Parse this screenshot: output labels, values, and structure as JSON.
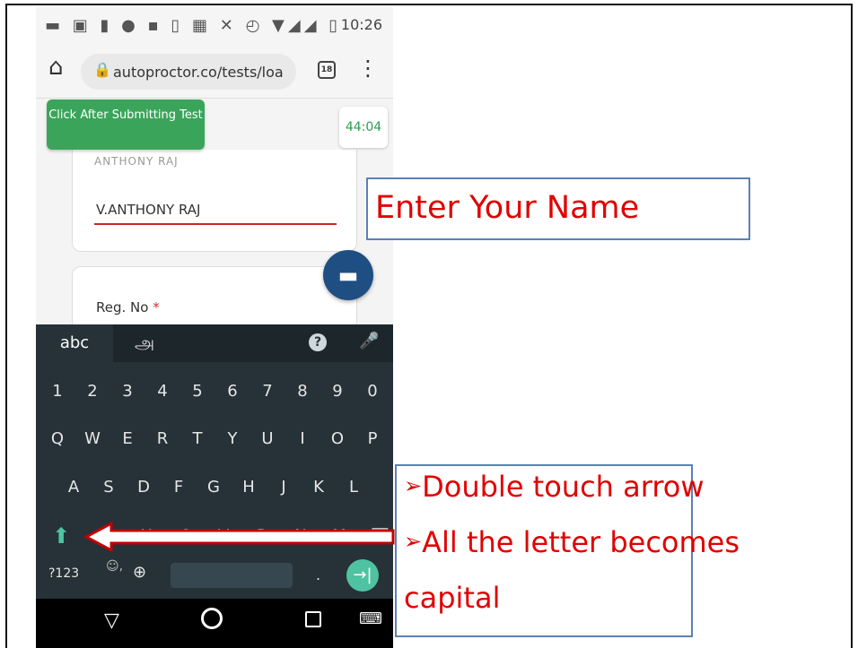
{
  "status_bar": {
    "icons": "▬ ▣ ▮ ● ▪ ▯ ▦ ✕ ◴ ▼◢◢ ▯",
    "time": "10:26"
  },
  "browser": {
    "home_icon": "⌂",
    "lock_icon": "🔒",
    "url": "autoproctor.co/tests/loa",
    "tab_count": "18",
    "menu_icon": "⋮"
  },
  "page": {
    "green_button": "Click After Submitting Test",
    "timer": "44:04",
    "faded_text": "ANTHONY RAJ",
    "name_value": "V.ANTHONY RAJ",
    "reg_label": "Reg. No",
    "required_star": "*",
    "chat_icon": "▬"
  },
  "keyboard": {
    "abc_tab": "abc",
    "tamil_tab": "அ",
    "help_icon": "?",
    "mic_icon": "🎤",
    "row_numbers": [
      "1",
      "2",
      "3",
      "4",
      "5",
      "6",
      "7",
      "8",
      "9",
      "0"
    ],
    "row_q": [
      "Q",
      "W",
      "E",
      "R",
      "T",
      "Y",
      "U",
      "I",
      "O",
      "P"
    ],
    "row_a": [
      "A",
      "S",
      "D",
      "F",
      "G",
      "H",
      "J",
      "K",
      "L"
    ],
    "row_z": [
      "Z",
      "X",
      "C",
      "V",
      "B",
      "N",
      "M",
      "⌫"
    ],
    "shift_icon": "⬆",
    "sym_key": "?123",
    "emoji_key": "☺,",
    "globe_key": "⊕",
    "period_key": ".",
    "enter_key": "→|"
  },
  "nav": {
    "back_icon": "▽",
    "keyboard_icon": "⌨"
  },
  "callouts": {
    "name_hint": "Enter Your Name",
    "bullet": "➢",
    "line1": "Double touch arrow",
    "line2": "All the letter becomes",
    "line3": "capital"
  },
  "colors": {
    "callout_text": "#e00000",
    "callout_border": "#5b80b7",
    "green_button": "#3aa55a",
    "keyboard_bg": "#263238",
    "accent_teal": "#4fc3a1",
    "arrow_outline": "#c00000"
  }
}
